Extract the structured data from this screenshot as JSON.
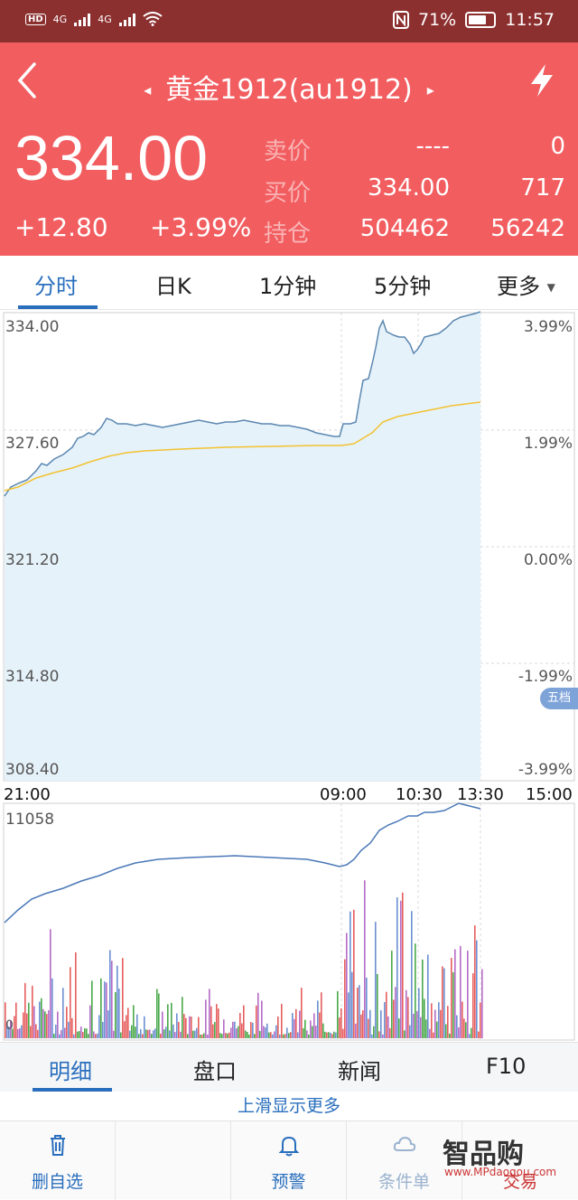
{
  "status_bar": {
    "hd": "HD",
    "net1": "4G",
    "net2": "4G",
    "battery_pct": "71%",
    "time": "11:57"
  },
  "header": {
    "title": "黄金1912(au1912)",
    "last_price": "334.00",
    "change_abs": "+12.80",
    "change_pct": "+3.99%",
    "quotes": [
      {
        "label": "卖价",
        "v1": "----",
        "v2": "0"
      },
      {
        "label": "买价",
        "v1": "334.00",
        "v2": "717"
      },
      {
        "label": "持仓",
        "v1": "504462",
        "v2": "56242"
      }
    ]
  },
  "tabs_top": [
    "分时",
    "日K",
    "1分钟",
    "5分钟",
    "更多"
  ],
  "chart": {
    "y_left": [
      "334.00",
      "327.60",
      "321.20",
      "314.80",
      "308.40"
    ],
    "y_right": [
      "3.99%",
      "1.99%",
      "0.00%",
      "-1.99%",
      "-3.99%"
    ],
    "time_labels": [
      "21:00",
      "09:00",
      "10:30",
      "13:30",
      "15:00"
    ],
    "volume_max": "11058",
    "volume_zero": "0",
    "wudang": "五档"
  },
  "chart_data": {
    "type": "line",
    "title": "",
    "x": [
      "21:00",
      "09:00",
      "10:30",
      "13:30",
      "15:00"
    ],
    "ylim": [
      308.4,
      334.0
    ],
    "series": [
      {
        "values": [
          325.0,
          329.3,
          329.0,
          334.0,
          334.0
        ]
      },
      {
        "values": [
          325.0,
          328.2,
          328.4,
          330.5,
          331.2
        ]
      }
    ],
    "volume": {
      "max": 11058,
      "min": 0
    }
  },
  "tabs_bottom": [
    "明细",
    "盘口",
    "新闻",
    "F10"
  ],
  "more_hint": "上滑显示更多",
  "toolbar": [
    "删自选",
    "",
    "预警",
    "条件单",
    "交易"
  ],
  "watermark": "智品购",
  "watermark_sub": "www.MPdaogou.com"
}
